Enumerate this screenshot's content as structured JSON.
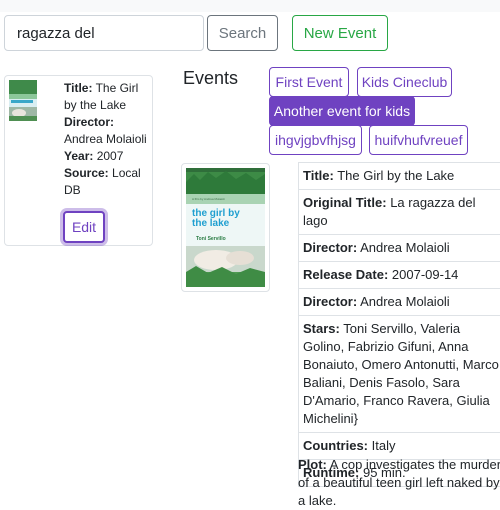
{
  "search": {
    "value": "ragazza del",
    "button_label": "Search"
  },
  "new_event_label": "New Event",
  "side_card": {
    "title_label": "Title:",
    "title_value": "The Girl by the Lake",
    "director_label": "Director:",
    "director_value": "Andrea Molaioli",
    "year_label": "Year:",
    "year_value": "2007",
    "source_label": "Source:",
    "source_value": "Local DB",
    "edit_label": "Edit"
  },
  "events": {
    "heading": "Events",
    "items": [
      {
        "label": "First Event",
        "active": false
      },
      {
        "label": "Kids Cineclub",
        "active": false
      },
      {
        "label": "Another event for kids",
        "active": true
      },
      {
        "label": "ihgvjgbvfhjsg",
        "active": false
      },
      {
        "label": "huifvhufvreuef",
        "active": false
      }
    ]
  },
  "poster": {
    "tagline": "A film by Andrea Molaioli",
    "title_text": "the girl by the lake",
    "credit": "Toni Servillo"
  },
  "details": {
    "title_label": "Title:",
    "title_value": "The Girl by the Lake",
    "original_title_label": "Original Title:",
    "original_title_value": "La ragazza del lago",
    "director_label": "Director:",
    "director_value": "Andrea Molaioli",
    "release_label": "Release Date:",
    "release_value": "2007-09-14",
    "director2_label": "Director:",
    "director2_value": "Andrea Molaioli",
    "stars_label": "Stars:",
    "stars_value": "Toni Servillo, Valeria Golino, Fabrizio Gifuni, Anna Bonaiuto, Omero Antonutti, Marco Baliani, Denis Fasolo, Sara D'Amario, Franco Ravera, Giulia Michelini}",
    "countries_label": "Countries:",
    "countries_value": "Italy",
    "runtime_label": "Runtime:",
    "runtime_value": "95 min."
  },
  "plot": {
    "label": "Plot:",
    "value": "A cop investigates the murder of a beautiful teen girl left naked by a lake."
  },
  "colors": {
    "accent": "#6f42c1",
    "success": "#28a745",
    "secondary": "#6c757d"
  }
}
